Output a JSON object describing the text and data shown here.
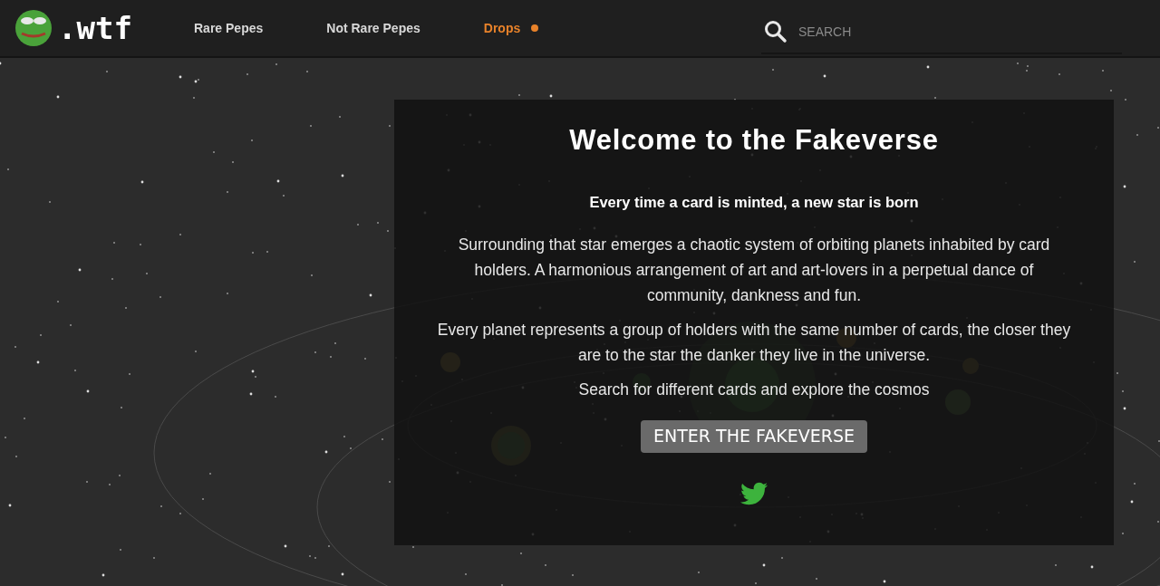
{
  "header": {
    "logo_text": ".wtf",
    "nav": [
      {
        "label": "Rare Pepes",
        "selected": false,
        "indicator": false
      },
      {
        "label": "Not Rare Pepes",
        "selected": false,
        "indicator": false
      },
      {
        "label": "Drops",
        "selected": true,
        "indicator": true
      }
    ],
    "search": {
      "placeholder": "SEARCH"
    }
  },
  "card": {
    "title": "Welcome to the Fakeverse",
    "tagline": "Every time a card is minted, a new star is born",
    "paragraphs": [
      "Surrounding that star emerges a chaotic system of orbiting planets inhabited by card holders. A harmonious arrangement of art and art-lovers in a perpetual dance of community, dankness and fun.",
      "Every planet represents a group of holders with the same number of cards, the closer they are to the star the danker they live in the universe.",
      "Search for different cards and explore the cosmos"
    ],
    "button": "ENTER THE FAKEVERSE"
  }
}
